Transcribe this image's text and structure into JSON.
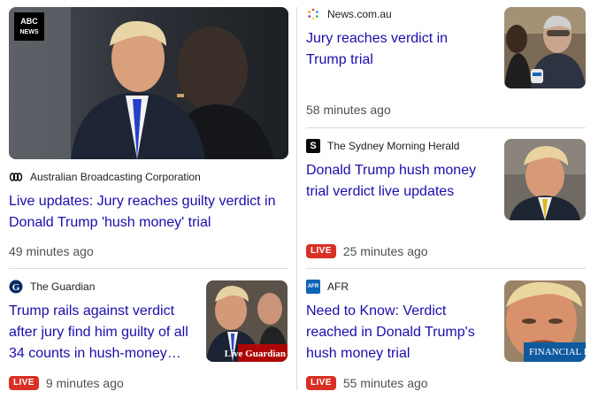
{
  "stories": {
    "abc": {
      "badge_top": "ABC",
      "badge_bottom": "NEWS",
      "source": "Australian Broadcasting Corporation",
      "headline": "Live updates: Jury reaches guilty verdict in Donald Trump 'hush money' trial",
      "time": "49 minutes ago"
    },
    "newscom": {
      "source": "News.com.au",
      "headline": "Jury reaches verdict in Trump trial",
      "time": "58 minutes ago"
    },
    "smh": {
      "logo_letter": "S",
      "source": "The Sydney Morning Herald",
      "headline": "Donald Trump hush money trial verdict live updates",
      "live": "LIVE",
      "time": "25 minutes ago"
    },
    "guardian": {
      "source": "The Guardian",
      "headline": "Trump rails against verdict after jury find him guilty of all 34 counts in hush-money…",
      "live": "LIVE",
      "time": "9 minutes ago",
      "watermark": "Live Guardian"
    },
    "afr": {
      "logo_letter": "AFR",
      "source": "AFR",
      "headline": "Need to Know: Verdict reached in Donald Trump's hush money trial",
      "live": "LIVE",
      "time": "55 minutes ago",
      "watermark": "FINANCIAL RE"
    }
  },
  "colors": {
    "headline": "#1a0dab",
    "live": "#d93025",
    "divider": "#dadce0"
  }
}
